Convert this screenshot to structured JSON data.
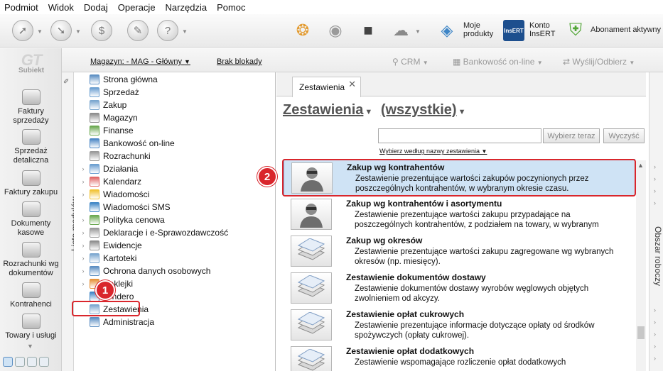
{
  "menu": [
    "Podmiot",
    "Widok",
    "Dodaj",
    "Operacje",
    "Narzędzia",
    "Pomoc"
  ],
  "toolbar": {
    "moje_produkty": "Moje produkty",
    "konto_insert": "Konto InsERT",
    "insert_logo_text": "InsERT",
    "abonament": "Abonament aktywny"
  },
  "logo": {
    "text": "GT",
    "sub": "Subiekt"
  },
  "leftnav": [
    "Faktury sprzedaży",
    "Sprzedaż detaliczna",
    "Faktury zakupu",
    "Dokumenty kasowe",
    "Rozrachunki wg dokumentów",
    "Kontrahenci",
    "Towary i usługi"
  ],
  "subbar": {
    "magazyn": "Magazyn: - MAG - Główny",
    "brak_blokady": "Brak blokady",
    "crm": "CRM",
    "bankowosc": "Bankowość on-line",
    "wyslij": "Wyślij/Odbierz"
  },
  "modules_strip_label": "Lista modułów",
  "modules": [
    {
      "label": "Strona główna",
      "exp": false,
      "color": "#5b8ec2"
    },
    {
      "label": "Sprzedaż",
      "exp": false,
      "color": "#6a9ed0"
    },
    {
      "label": "Zakup",
      "exp": false,
      "color": "#7aa6cf"
    },
    {
      "label": "Magazyn",
      "exp": false,
      "color": "#8c8c8c"
    },
    {
      "label": "Finanse",
      "exp": false,
      "color": "#6aa84f"
    },
    {
      "label": "Bankowość on-line",
      "exp": false,
      "color": "#4a86c5"
    },
    {
      "label": "Rozrachunki",
      "exp": false,
      "color": "#999999"
    },
    {
      "label": "Działania",
      "exp": true,
      "color": "#6a9ed0"
    },
    {
      "label": "Kalendarz",
      "exp": true,
      "color": "#e06666"
    },
    {
      "label": "Wiadomości",
      "exp": true,
      "color": "#f1c232"
    },
    {
      "label": "Wiadomości SMS",
      "exp": false,
      "color": "#3d85c6"
    },
    {
      "label": "Polityka cenowa",
      "exp": true,
      "color": "#6aa84f"
    },
    {
      "label": "Deklaracje i e-Sprawozdawczość",
      "exp": true,
      "color": "#999999"
    },
    {
      "label": "Ewidencje",
      "exp": true,
      "color": "#8c8c8c"
    },
    {
      "label": "Kartoteki",
      "exp": true,
      "color": "#7aa6cf"
    },
    {
      "label": "Ochrona danych osobowych",
      "exp": true,
      "color": "#5b8ec2"
    },
    {
      "label": "Naklejki",
      "exp": true,
      "color": "#e69138"
    },
    {
      "label": "vendero",
      "exp": false,
      "color": "#3d85c6"
    },
    {
      "label": "Zestawienia",
      "exp": false,
      "color": "#7aa6cf"
    },
    {
      "label": "Administracja",
      "exp": false,
      "color": "#5b8ec2"
    }
  ],
  "tab": {
    "label": "Zestawienia",
    "close": "✕"
  },
  "heading": {
    "title": "Zestawienia",
    "filter": "(wszystkie)"
  },
  "search": {
    "placeholder": "",
    "btn_wybierz": "Wybierz teraz",
    "btn_wyczysc": "Wyczyść",
    "sort_link": "Wybierz według nazwy zestawienia"
  },
  "items": [
    {
      "title": "Zakup wg kontrahentów",
      "desc": "Zestawienie prezentujące wartości zakupów poczynionych przez poszczególnych kontrahentów, w wybranym okresie czasu.",
      "icon": "person"
    },
    {
      "title": "Zakup wg kontrahentów i asortymentu",
      "desc": "Zestawienie prezentujące wartości zakupu przypadające na poszczególnych kontrahentów, z podziałem na towary, w wybranym",
      "icon": "person"
    },
    {
      "title": "Zakup wg okresów",
      "desc": "Zestawienie prezentujące wartości zakupu zagregowane wg wybranych okresów (np. miesięcy).",
      "icon": "stack"
    },
    {
      "title": "Zestawienie dokumentów dostawy",
      "desc": "Zestawienie dokumentów dostawy wyrobów węglowych objętych zwolnieniem od akcyzy.",
      "icon": "stack"
    },
    {
      "title": "Zestawienie opłat cukrowych",
      "desc": "Zestawienie prezentujące informacje dotyczące opłaty od środków spożywczych (opłaty cukrowej).",
      "icon": "stack"
    },
    {
      "title": "Zestawienie opłat dodatkowych",
      "desc": "Zestawienie wspomagające rozliczenie opłat dodatkowych",
      "icon": "stack"
    }
  ],
  "right_strip_label": "Obszar roboczy",
  "badges": {
    "b1": "1",
    "b2": "2"
  }
}
